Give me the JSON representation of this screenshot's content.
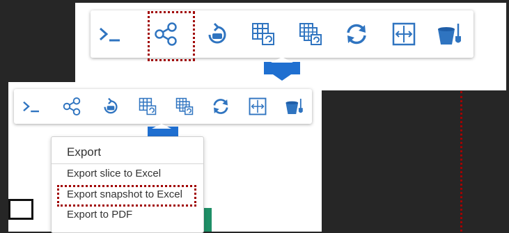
{
  "toolbar_top": {
    "tools": [
      {
        "name": "console-icon"
      },
      {
        "name": "share-icon"
      },
      {
        "name": "refresh-export-icon"
      },
      {
        "name": "grid-refresh-icon"
      },
      {
        "name": "multi-grid-refresh-icon"
      },
      {
        "name": "sync-icon"
      },
      {
        "name": "fit-width-icon"
      },
      {
        "name": "bucket-shovel-icon"
      }
    ],
    "highlight_color": "#a00000",
    "accent_color": "#1f6fd0"
  },
  "toolbar_bottom": {
    "tools": [
      {
        "name": "console-icon"
      },
      {
        "name": "share-icon"
      },
      {
        "name": "refresh-export-icon"
      },
      {
        "name": "grid-refresh-icon"
      },
      {
        "name": "multi-grid-refresh-icon"
      },
      {
        "name": "sync-icon"
      },
      {
        "name": "fit-width-icon"
      },
      {
        "name": "bucket-shovel-icon"
      }
    ]
  },
  "export_menu": {
    "title": "Export",
    "items": [
      {
        "label": "Export slice to Excel"
      },
      {
        "label": "Export snapshot to Excel"
      },
      {
        "label": "Export to PDF"
      }
    ]
  }
}
